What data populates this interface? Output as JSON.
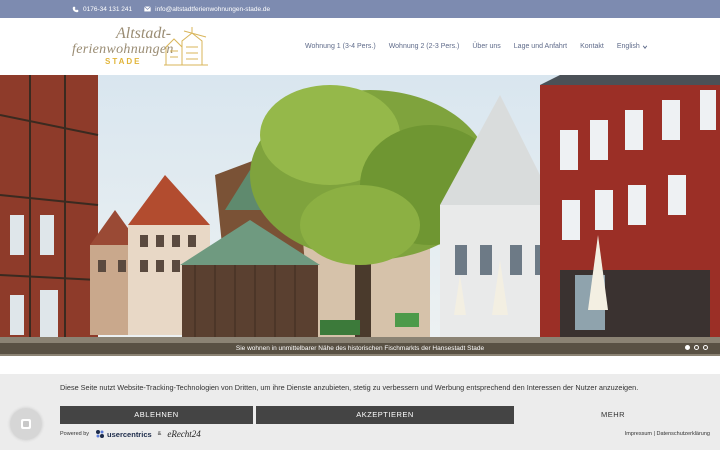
{
  "topbar": {
    "phone": "0176-34 131 241",
    "email": "info@altstadtferienwohnungen-stade.de",
    "phone_icon": "phone-icon",
    "email_icon": "envelope-icon"
  },
  "logo": {
    "line1": "Altstadt-",
    "line2": "ferienwohnungen",
    "line3": "STADE"
  },
  "nav": {
    "items": [
      "Wohnung 1 (3-4 Pers.)",
      "Wohnung 2 (2-3 Pers.)",
      "Über uns",
      "Lage und Anfahrt",
      "Kontakt"
    ],
    "language": "English",
    "language_icon": "chevron-down-icon"
  },
  "hero": {
    "caption": "Sie wohnen in unmittelbarer Nähe des historischen Fischmarkts der Hansestadt Stade",
    "slides_total": 3,
    "active_slide": 1
  },
  "cookie": {
    "text": "Diese Seite nutzt Website-Tracking-Technologien von Dritten, um ihre Dienste anzubieten, stetig zu verbessern und Werbung entsprechend den Interessen der Nutzer anzuzeigen.",
    "reject": "ABLEHNEN",
    "accept": "AKZEPTIEREN",
    "more": "MEHR",
    "powered_by": "Powered by",
    "usercentrics": "usercentrics",
    "ampersand": "&",
    "erecht": "eRecht24",
    "imprint": "Impressum",
    "separator": "|",
    "privacy": "Datenschutzerklärung"
  },
  "colors": {
    "topbar": "#7d8bb0",
    "nav_text": "#5f6b8a",
    "button_dark": "#444444",
    "banner_bg": "#ececec",
    "logo_gold": "#e1b53a"
  }
}
